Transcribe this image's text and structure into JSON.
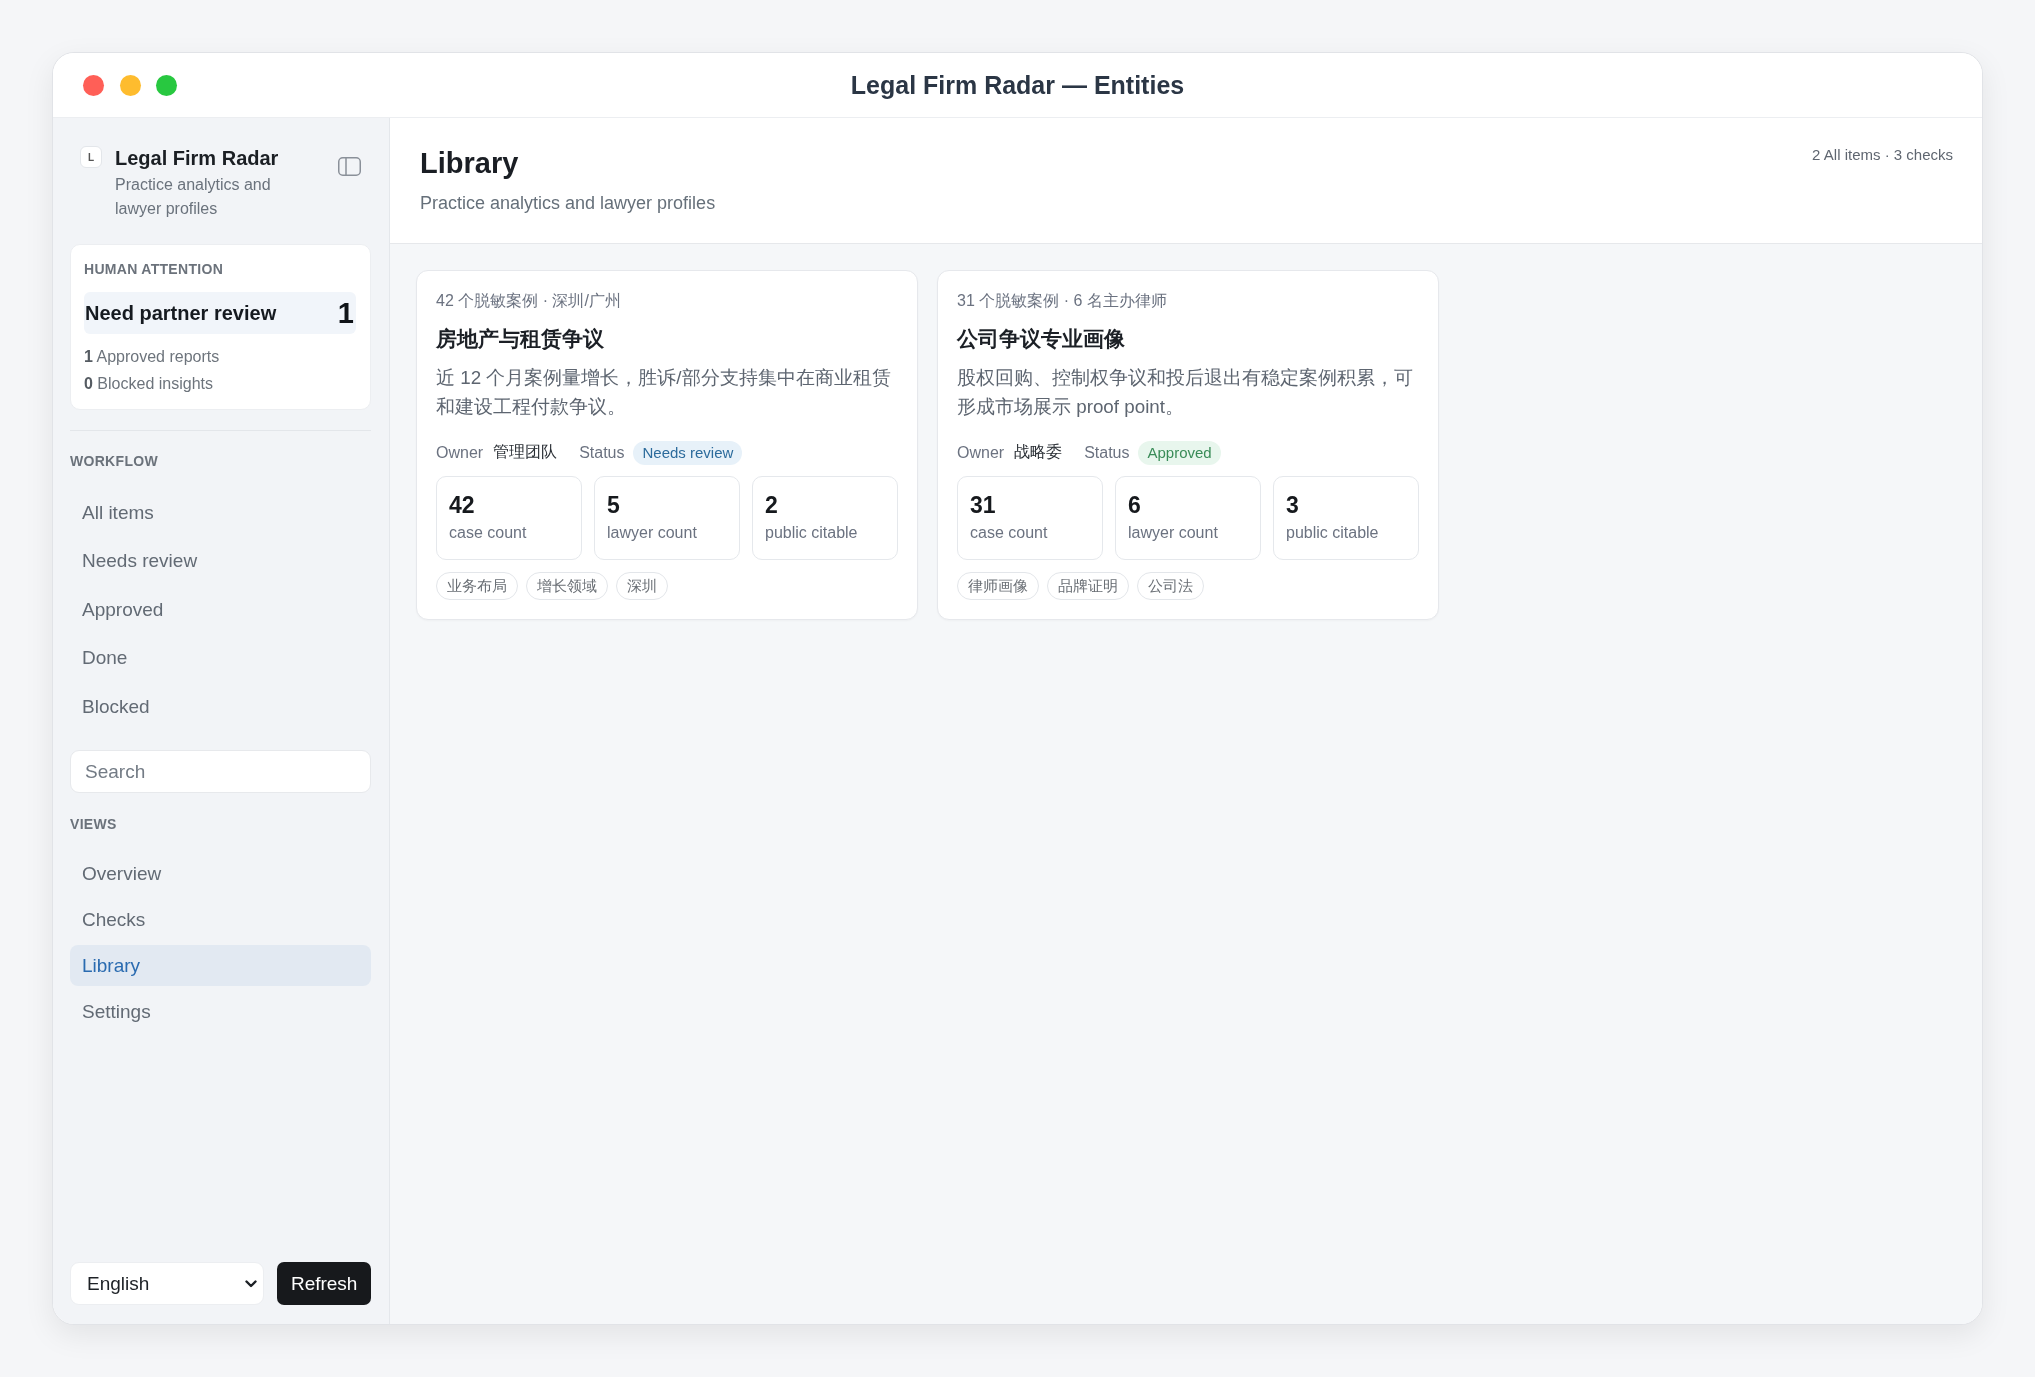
{
  "window": {
    "title": "Legal Firm Radar — Entities"
  },
  "sidebar": {
    "logo": "L",
    "app_name": "Legal Firm Radar",
    "tagline": "Practice analytics and lawyer profiles",
    "attention": {
      "heading": "HUMAN ATTENTION",
      "highlight": {
        "label": "Need partner review",
        "count": "1"
      },
      "stats": [
        "**1** Approved reports",
        "**0** Blocked insights"
      ]
    },
    "workflow": {
      "heading": "WORKFLOW",
      "items": [
        {
          "label": "All items",
          "selected": false
        },
        {
          "label": "Needs review",
          "selected": false
        },
        {
          "label": "Approved",
          "selected": false
        },
        {
          "label": "Done",
          "selected": false
        },
        {
          "label": "Blocked",
          "selected": false
        }
      ]
    },
    "search": {
      "placeholder": "Search"
    },
    "views": {
      "heading": "VIEWS",
      "items": [
        {
          "label": "Overview",
          "selected": false
        },
        {
          "label": "Checks",
          "selected": false
        },
        {
          "label": "Library",
          "selected": true
        },
        {
          "label": "Settings",
          "selected": false
        }
      ]
    },
    "footer": {
      "language": "English",
      "refresh": "Refresh"
    }
  },
  "main": {
    "title": "Library",
    "subtitle": "Practice analytics and lawyer profiles",
    "summary": "2 All items · 3 checks",
    "cards": [
      {
        "meta": "42 个脱敏案例 · 深圳/广州",
        "title": "房地产与租赁争议",
        "description": "近 12 个月案例量增长，胜诉/部分支持集中在商业租赁和建设工程付款争议。",
        "owner_label": "Owner",
        "owner": "管理团队",
        "status_label": "Status",
        "status": {
          "label": "Needs review",
          "kind": "review"
        },
        "stats": [
          {
            "value": "42",
            "label": "case count"
          },
          {
            "value": "5",
            "label": "lawyer count"
          },
          {
            "value": "2",
            "label": "public citable"
          }
        ],
        "tags": [
          "业务布局",
          "增长领域",
          "深圳"
        ]
      },
      {
        "meta": "31 个脱敏案例 · 6 名主办律师",
        "title": "公司争议专业画像",
        "description": "股权回购、控制权争议和投后退出有稳定案例积累，可形成市场展示 proof point。",
        "owner_label": "Owner",
        "owner": "战略委",
        "status_label": "Status",
        "status": {
          "label": "Approved",
          "kind": "approved"
        },
        "stats": [
          {
            "value": "31",
            "label": "case count"
          },
          {
            "value": "6",
            "label": "lawyer count"
          },
          {
            "value": "3",
            "label": "public citable"
          }
        ],
        "tags": [
          "律师画像",
          "品牌证明",
          "公司法"
        ]
      }
    ]
  }
}
